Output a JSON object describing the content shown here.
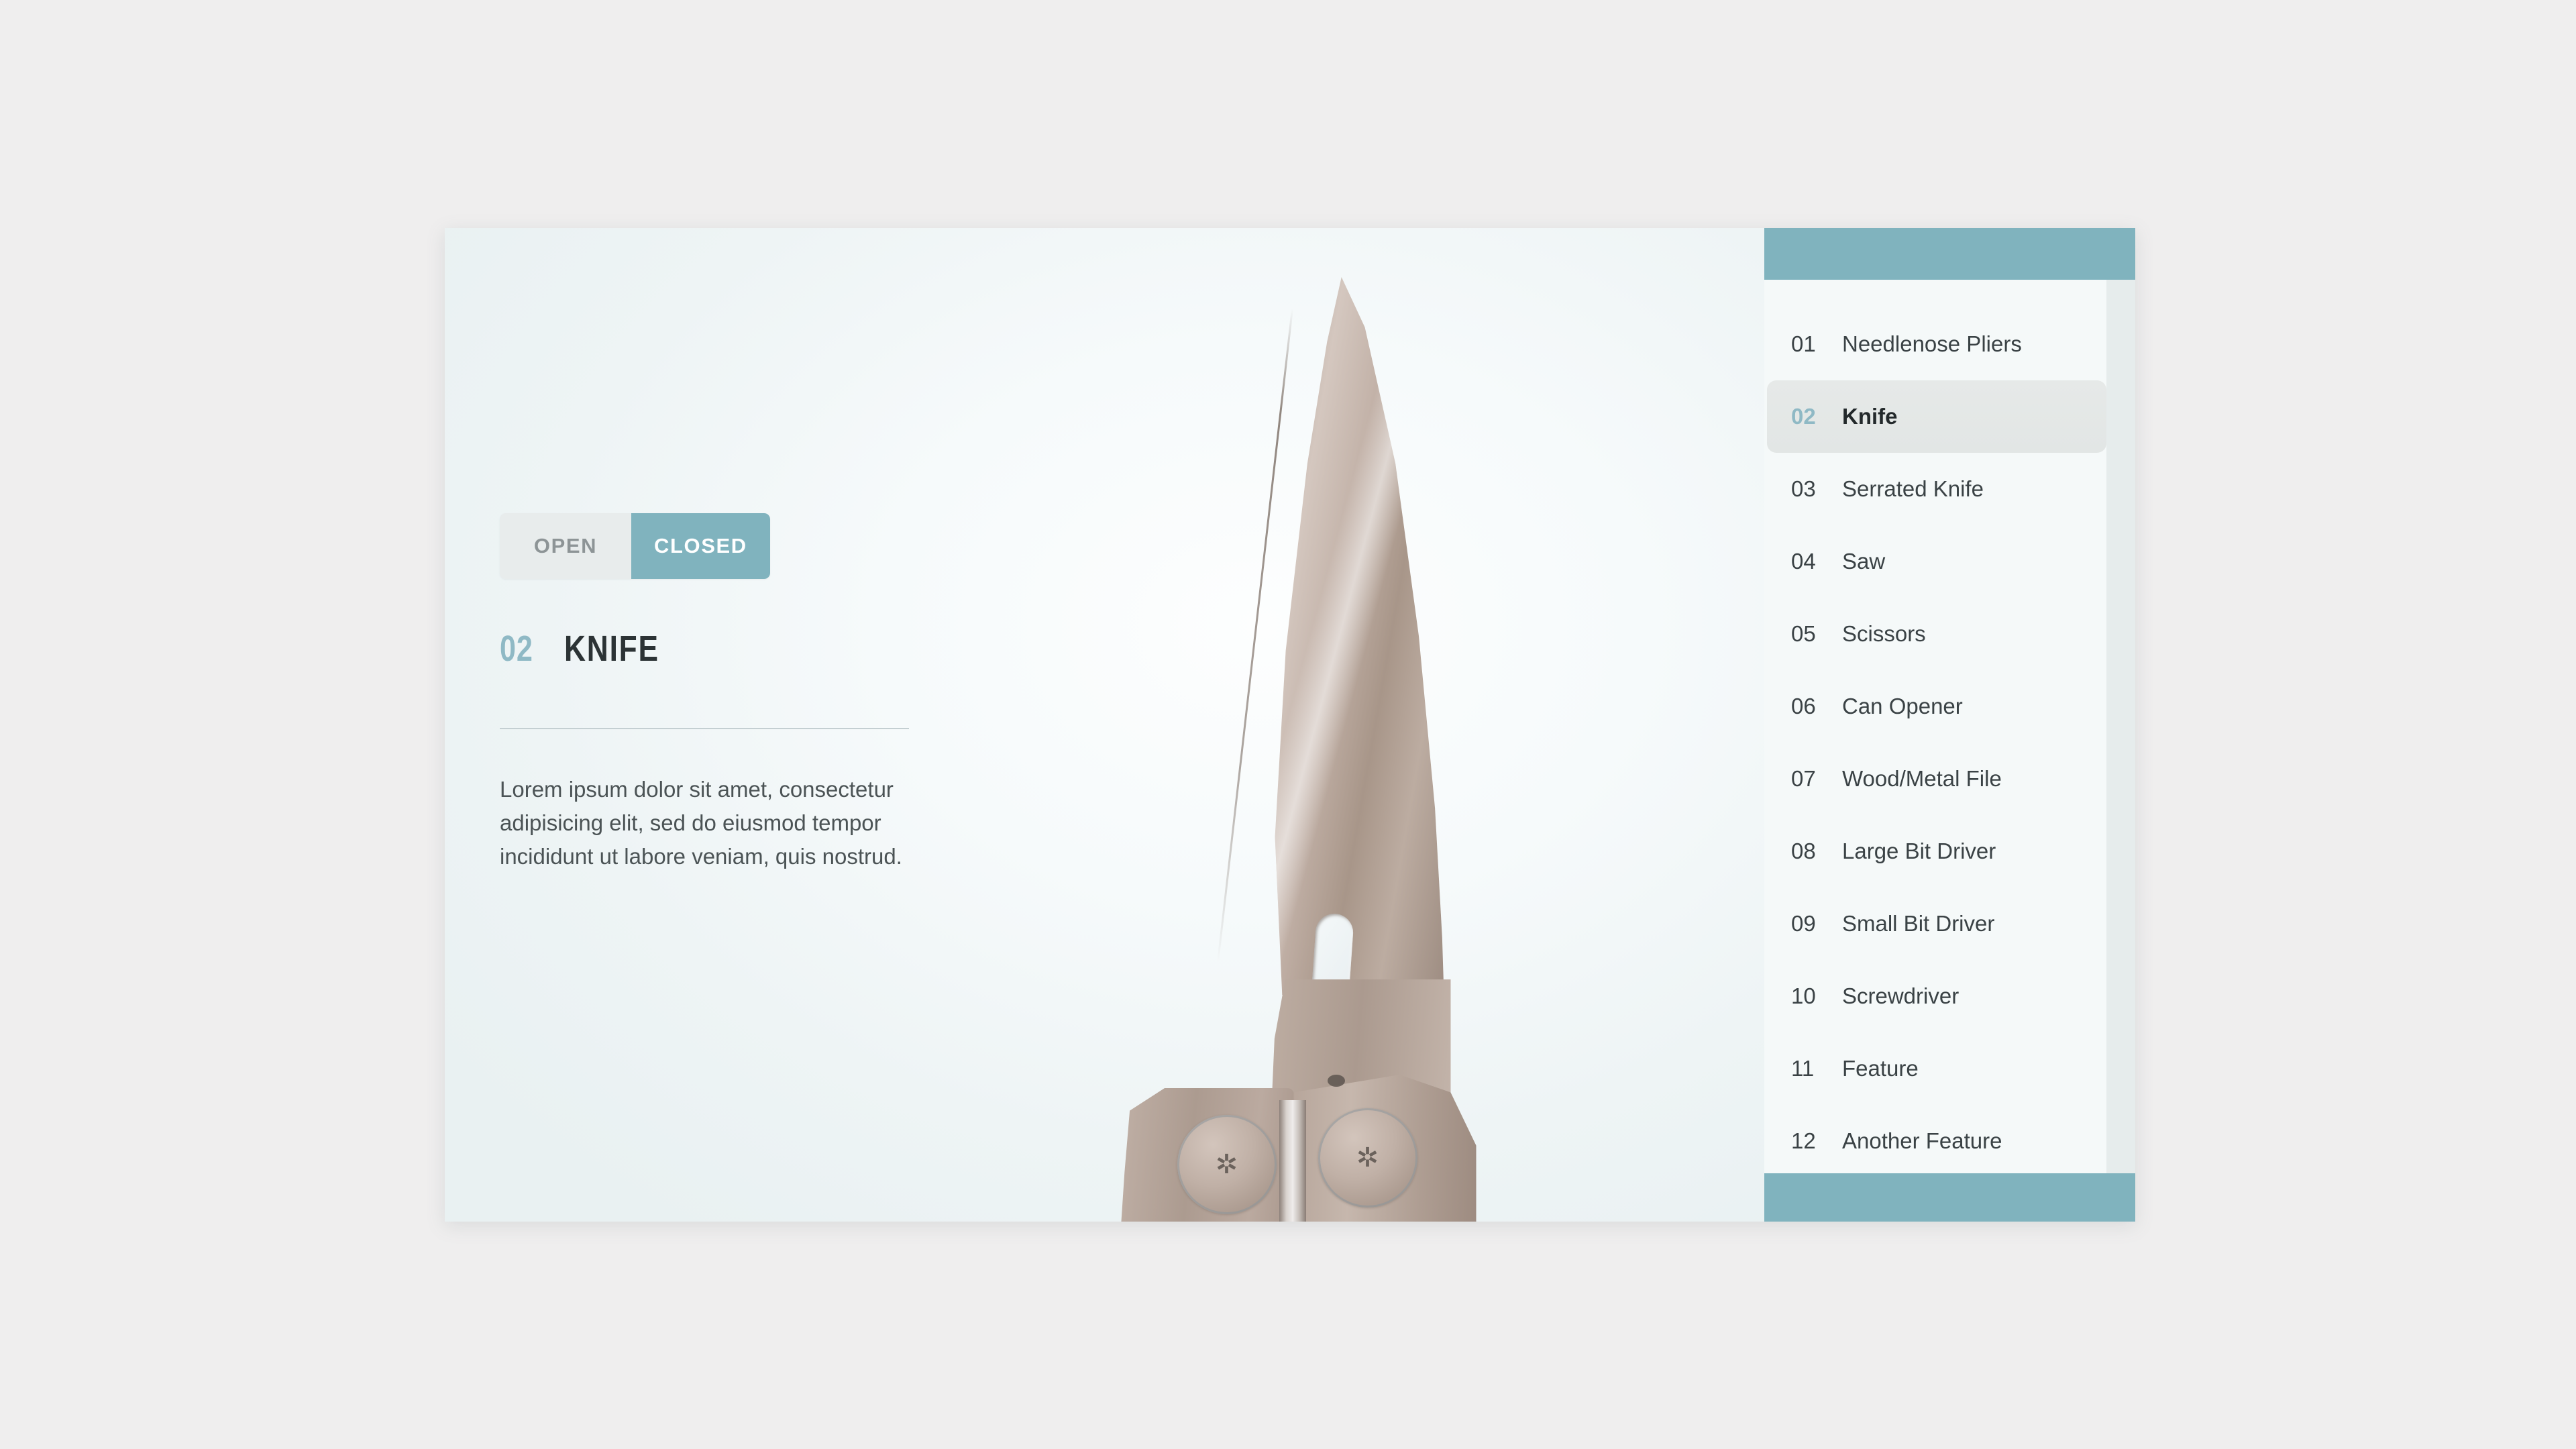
{
  "toggle": {
    "open_label": "OPEN",
    "closed_label": "CLOSED",
    "selected": "CLOSED"
  },
  "detail": {
    "number": "02",
    "title": "KNIFE",
    "description": "Lorem ipsum dolor sit amet, consectetur adipisicing elit, sed do eiusmod tempor incididunt ut labore veniam, quis nostrud."
  },
  "product_image": {
    "alt": "multitool-knife-closed",
    "screw_glyph": "✲"
  },
  "sidebar": {
    "items": [
      {
        "num": "01",
        "label": "Needlenose Pliers",
        "active": false
      },
      {
        "num": "02",
        "label": "Knife",
        "active": true
      },
      {
        "num": "03",
        "label": "Serrated Knife",
        "active": false
      },
      {
        "num": "04",
        "label": "Saw",
        "active": false
      },
      {
        "num": "05",
        "label": "Scissors",
        "active": false
      },
      {
        "num": "06",
        "label": "Can Opener",
        "active": false
      },
      {
        "num": "07",
        "label": "Wood/Metal File",
        "active": false
      },
      {
        "num": "08",
        "label": "Large Bit Driver",
        "active": false
      },
      {
        "num": "09",
        "label": "Small Bit Driver",
        "active": false
      },
      {
        "num": "10",
        "label": "Screwdriver",
        "active": false
      },
      {
        "num": "11",
        "label": "Feature",
        "active": false
      },
      {
        "num": "12",
        "label": "Another Feature",
        "active": false
      }
    ]
  },
  "colors": {
    "accent_teal": "#80b3be",
    "accent_teal_light": "#8fb9c5",
    "card_bg": "#edf3f4",
    "page_bg": "#efeeee",
    "text_dark": "#2c3335",
    "text_body": "#4b5355",
    "toggle_inactive_bg": "#e8ecec"
  }
}
